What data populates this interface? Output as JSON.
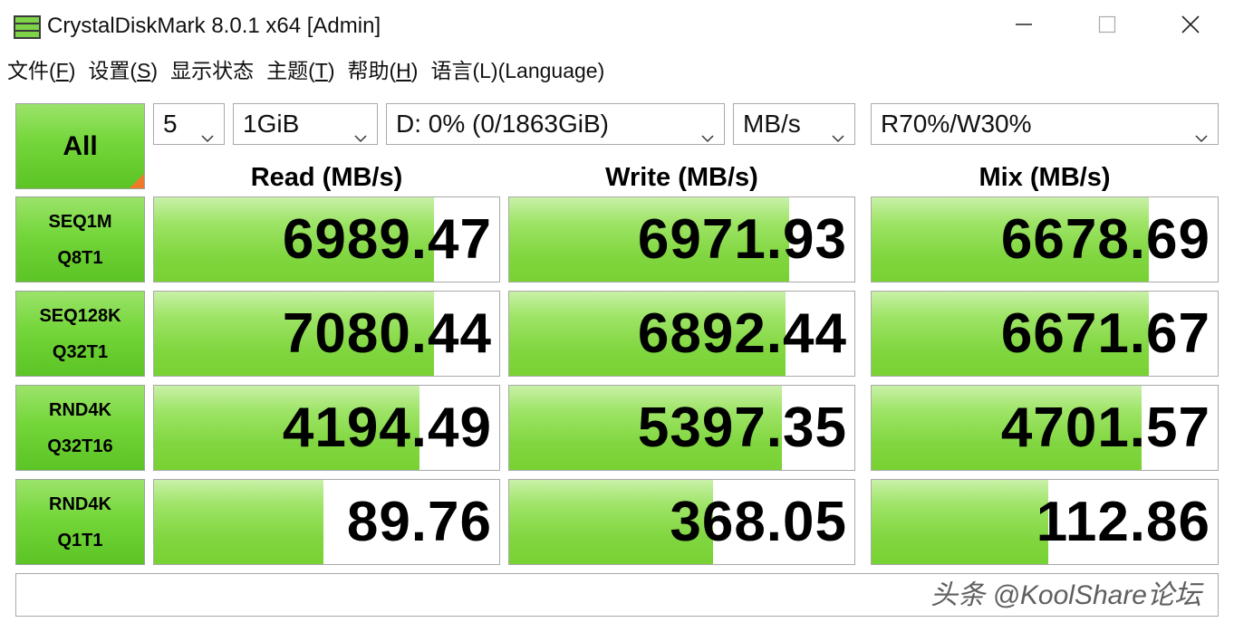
{
  "window": {
    "title": "CrystalDiskMark 8.0.1 x64 [Admin]",
    "icon": "disk-icon"
  },
  "menu": [
    {
      "label": "文件(",
      "key": "F",
      "suffix": ")"
    },
    {
      "label": "设置(",
      "key": "S",
      "suffix": ")"
    },
    {
      "label": "显示状态",
      "key": "",
      "suffix": ""
    },
    {
      "label": "主题(",
      "key": "T",
      "suffix": ")"
    },
    {
      "label": "帮助(",
      "key": "H",
      "suffix": ")"
    },
    {
      "label": "语言(L)(Language)",
      "key": "",
      "suffix": ""
    }
  ],
  "controls": {
    "all_label": "All",
    "count": "5",
    "size": "1GiB",
    "drive": "D: 0% (0/1863GiB)",
    "unit": "MB/s",
    "mix": "R70%/W30%"
  },
  "headers": {
    "read": "Read (MB/s)",
    "write": "Write (MB/s)",
    "mix": "Mix (MB/s)"
  },
  "rows": [
    {
      "line1": "SEQ1M",
      "line2": "Q8T1",
      "read": "6989.47",
      "write": "6971.93",
      "mix": "6678.69",
      "read_fill": 0.81,
      "write_fill": 0.81,
      "mix_fill": 0.8
    },
    {
      "line1": "SEQ128K",
      "line2": "Q32T1",
      "read": "7080.44",
      "write": "6892.44",
      "mix": "6671.67",
      "read_fill": 0.81,
      "write_fill": 0.8,
      "mix_fill": 0.8
    },
    {
      "line1": "RND4K",
      "line2": "Q32T16",
      "read": "4194.49",
      "write": "5397.35",
      "mix": "4701.57",
      "read_fill": 0.77,
      "write_fill": 0.79,
      "mix_fill": 0.78
    },
    {
      "line1": "RND4K",
      "line2": "Q1T1",
      "read": "89.76",
      "write": "368.05",
      "mix": "112.86",
      "read_fill": 0.49,
      "write_fill": 0.59,
      "mix_fill": 0.51
    }
  ],
  "comment": "",
  "watermark": "头条 @KoolShare论坛",
  "colors": {
    "bar_green": "#80d63f",
    "button_green": "#74d63a",
    "corner_orange": "#f07a2a"
  }
}
